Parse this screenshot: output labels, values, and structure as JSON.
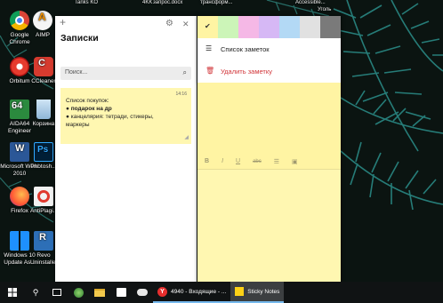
{
  "desktop": {
    "top_labels": [
      "Tanks KO",
      "4KK",
      "запрос.docx",
      "трансформ...",
      "Accessible...",
      "Уголь"
    ],
    "icons": [
      {
        "label": "Google Chrome",
        "kind": "chrome"
      },
      {
        "label": "AIMP",
        "kind": "aimp"
      },
      {
        "label": "Orbitum",
        "kind": "orbitum"
      },
      {
        "label": "CCleaner",
        "kind": "ccleaner"
      },
      {
        "label": "AIDA64 Engineer",
        "kind": "aida"
      },
      {
        "label": "Корзина",
        "kind": "recycle"
      },
      {
        "label": "Microsoft Word 2010",
        "kind": "word"
      },
      {
        "label": "Photosh...",
        "kind": "photoshop"
      },
      {
        "label": "Firefox",
        "kind": "firefox"
      },
      {
        "label": "AntiPlagi...",
        "kind": "antiplag"
      },
      {
        "label": "Windows 10 Update As...",
        "kind": "winupdate"
      },
      {
        "label": "Revo Uninstaller",
        "kind": "revo"
      }
    ]
  },
  "notes_list": {
    "add_icon": "+",
    "settings_icon": "⚙",
    "close_icon": "✕",
    "title": "Записки",
    "search_placeholder": "Поиск...",
    "note": {
      "time": "14:16",
      "line1": "Список покупок:",
      "line2": "подарок на др",
      "line3": "канцелярия: тетради, стикеры,",
      "line4": "маркеры"
    }
  },
  "sticky_note": {
    "colors": [
      {
        "name": "yellow",
        "hex": "#fff4a3",
        "selected": true
      },
      {
        "name": "green",
        "hex": "#ccf5b8"
      },
      {
        "name": "pink",
        "hex": "#f5b8e6"
      },
      {
        "name": "purple",
        "hex": "#d6b8f5"
      },
      {
        "name": "blue",
        "hex": "#b3d9f5"
      },
      {
        "name": "gray",
        "hex": "#e1e1e1"
      },
      {
        "name": "charcoal",
        "hex": "#7a7a7a"
      }
    ],
    "menu": {
      "list_label": "Список заметок",
      "delete_label": "Удалить заметку",
      "delete_color": "#d13438"
    },
    "format_bar": [
      "B",
      "I",
      "U",
      "abc",
      "list",
      "image"
    ]
  },
  "taskbar": {
    "yandex_label": "4940 - Входящие - ...",
    "sticky_label": "Sticky Notes"
  }
}
